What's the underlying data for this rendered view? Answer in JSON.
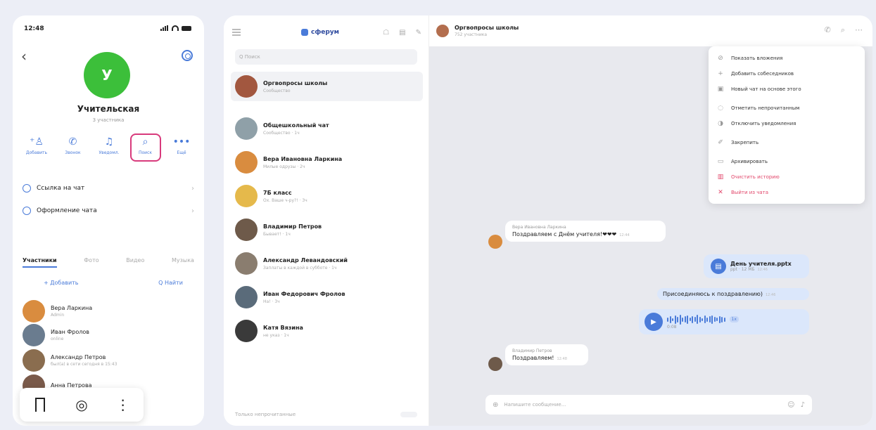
{
  "mobile": {
    "time": "12:48",
    "avatar_letter": "У",
    "group_name": "Учительская",
    "members_count": "3 участника",
    "actions": [
      {
        "label": "Добавить",
        "icon": "add-member-icon"
      },
      {
        "label": "Звонок",
        "icon": "phone-icon"
      },
      {
        "label": "Уведомл.",
        "icon": "bell-icon"
      },
      {
        "label": "Поиск",
        "icon": "search-icon"
      },
      {
        "label": "Ещё",
        "icon": "more-icon"
      }
    ],
    "rows": [
      {
        "label": "Ссылка на чат"
      },
      {
        "label": "Оформление чата"
      }
    ],
    "tabs": [
      "Участники",
      "Фото",
      "Видео",
      "Музыка"
    ],
    "tools": {
      "add": "+ Добавить",
      "find": "Q Найти"
    },
    "members": [
      {
        "name": "Вера Ларкина",
        "sub": "Admin",
        "color": "#d98c3f"
      },
      {
        "name": "Иван Фролов",
        "sub": "online",
        "color": "#6a7c8f"
      },
      {
        "name": "Александр Петров",
        "sub": "был(а) в сети сегодня в 15:43",
        "color": "#8a6d4f"
      },
      {
        "name": "Анна Петрова",
        "sub": "",
        "color": "#7a5a4a"
      }
    ]
  },
  "desktop": {
    "brand": "сферум",
    "search_placeholder": "Q Поиск",
    "chats": [
      {
        "name": "Оргвопросы школы",
        "sub": "Сообщество",
        "color": "#a2573f",
        "selected": true
      },
      {
        "name": "Общешкольный чат",
        "sub": "Сообщество · 1ч",
        "color": "#8fa0a8",
        "selected": false
      },
      {
        "name": "Вера Ивановна Ларкина",
        "sub": "Милые одрузы · 2ч",
        "color": "#d98c3f",
        "selected": false
      },
      {
        "name": "7Б класс",
        "sub": "Ох. Ваше ч-ру?! · 3ч",
        "color": "#e5b94b",
        "selected": false
      },
      {
        "name": "Владимир Петров",
        "sub": "Бывает! · 1ч",
        "color": "#6e5a4a",
        "selected": false
      },
      {
        "name": "Александр Левандовский",
        "sub": "Заплаты в каждой в субботе · 1ч",
        "color": "#8a7d6f",
        "selected": false
      },
      {
        "name": "Иван Федорович Фролов",
        "sub": "Hа! · 3ч",
        "color": "#5a6b7a",
        "selected": false
      },
      {
        "name": "Катя Вязина",
        "sub": "не указ · 1ч",
        "color": "#3a3a3a",
        "selected": false
      }
    ],
    "footer_label": "Только непрочитанные",
    "chat_header": {
      "name": "Оргвопросы школы",
      "sub": "752 участника"
    },
    "menu": [
      {
        "label": "Показать вложения",
        "icon": "attachment-icon",
        "danger": false,
        "sep": false
      },
      {
        "label": "Добавить собеседников",
        "icon": "plus-icon",
        "danger": false,
        "sep": false
      },
      {
        "label": "Новый чат на основе этого",
        "icon": "new-chat-icon",
        "danger": false,
        "sep": false
      },
      {
        "label": "Отметить непрочитанным",
        "icon": "unread-icon",
        "danger": false,
        "sep": true
      },
      {
        "label": "Отключить уведомления",
        "icon": "mute-icon",
        "danger": false,
        "sep": false
      },
      {
        "label": "Закрепить",
        "icon": "pin-icon",
        "danger": false,
        "sep": true
      },
      {
        "label": "Архивировать",
        "icon": "archive-icon",
        "danger": false,
        "sep": true
      },
      {
        "label": "Очистить историю",
        "icon": "trash-icon",
        "danger": true,
        "sep": false
      },
      {
        "label": "Выйти из чата",
        "icon": "exit-icon",
        "danger": true,
        "sep": false
      }
    ],
    "messages": {
      "m1_author": "Вера Ивановна Ларкина",
      "m1_text": "Поздравляем с Днём учителя!❤❤❤",
      "m1_time": "12:44",
      "file_name": "День учителя.pptx",
      "file_size": "ppt · 12 МБ",
      "file_time": "12:46",
      "join_text": "Присоединяюсь к поздравлению)",
      "join_time": "12:46",
      "voice_time": "0:08",
      "voice_speed": "1x",
      "m2_author": "Владимир Петров",
      "m2_text": "Поздравляем!",
      "m2_time": "12:48"
    },
    "composer_placeholder": "Напишите сообщение..."
  }
}
